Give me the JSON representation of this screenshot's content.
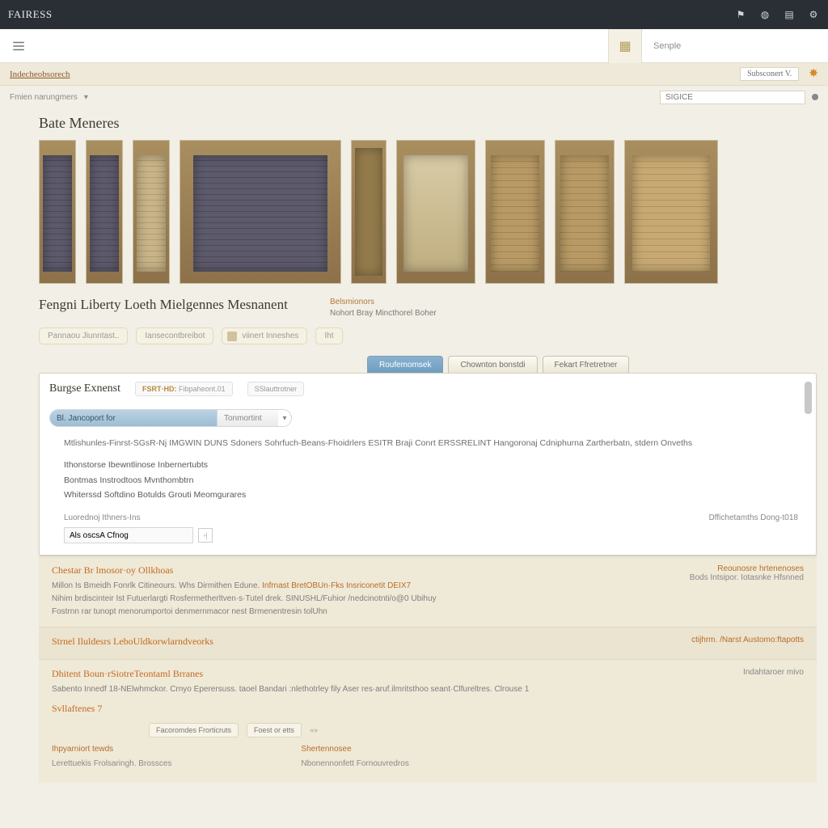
{
  "topbar": {
    "brand": "FAIRESS"
  },
  "search": {
    "placeholder": "",
    "btn_label": "Senple"
  },
  "breadcrumb": {
    "crumb1": "Indecheobsorech",
    "date_text": "",
    "subscribe": "Subsconert V.",
    "filter_label1": "Fmien narungmers",
    "filter_sel": "SIGICE"
  },
  "gallery_heading": "Bate Meneres",
  "title": "Fengni Liberty Loeth Mielgennes Mesnanent",
  "title_meta": {
    "l1": "Belsmionors",
    "l2": "Nohort Bray Mincthorel Boher"
  },
  "pills": {
    "p1": "Pannaou Jiunntast..",
    "p2": "Iansecontbreibot",
    "p3": "viinert Inneshes",
    "p4": "Iht"
  },
  "tabs": {
    "t1": "Roufemomsek",
    "t2": "Chownton bonstdi",
    "t3": "Fekart Ffretretner"
  },
  "panel": {
    "head": "Burgse Exnenst",
    "tag1_label": "FSRT·HD:",
    "tag1_val": "Fibpaheont.01",
    "tag2": "SSlauttrotner",
    "sw_a": "Bl. Jancoport for",
    "sw_b": "Tonmortint",
    "sw_c": "▾",
    "desc": "Mtlishunles-Finrst-SGsR-Nj IMGWIN DUNS Sdoners Sohrfuch-Beans-Fhoidrlers ESITR Braji Conrt ERSSRELINT Hangoronaj Cdniphurna Zartherbatn, stdern Onveths",
    "li1": "Ithonstorse Ibewntlinose Inbernertubts",
    "li2": "Bontmas Instrodtoos Mvnthombtrn",
    "li3": "Whiterssd Softdino Botulds Grouti Meomgurares",
    "sub_l": "Luorednoj Ithners-Ins",
    "sub_r": "Dffichetamths Dong-t018",
    "sub_input": "Als oscsA Cfnog"
  },
  "rec1": {
    "h": "Chestar Br lmosor·oy Ollkhoas",
    "l1a": "Millon Is Bmeidh Fonrlk Citineours. Whs Dirmithen Edune.",
    "l1b": " Infrnast BretOBUn·Fks Insriconetit DEIX7",
    "l2": "Nihim brdiscinteir Ist Futuerlargti Rosfermetherltven·s·Tutel drek. SINUSHL/Fuhior /nedcinotnti/o@0 Ubihuy",
    "l3": "Fostrnn rar tunopt menorumportoi denmernmacor nest Brmenentresin tolUhn",
    "r1": "Reounosre hrtenenoses",
    "r2": "Bods Intsipor.  Iotasnke Hfsnned"
  },
  "rec2": {
    "h": "Strnel Iluldesrs LeboUldkorwlarndveorks",
    "r": "ctijhrm. /Narst Austomo:ftapotts"
  },
  "rec3": {
    "h": "Dhitent Boun·rSiotreTeontaml Brranes",
    "l1": "Sabento Innedf 18-NElwhmckor. Crnyo Eperersuss. taoel Bandari :nlethotrley fily Aser res·aruf.ilmritsthoo seant·Clfureltres.   Clrouse 1",
    "r1": "Indahtaroer mivo",
    "sub_h": "Svllaftenes 7",
    "btn1": "Facoromdes Frorticruts",
    "btn2": "Foest or etts",
    "f1a": "Ihpyarniort tewds",
    "f1b": "Lerettuekis Frolsaringh. Brossces",
    "f2a": "Shertennosee",
    "f2b": "Nbonennonfett Fornouvredros"
  }
}
